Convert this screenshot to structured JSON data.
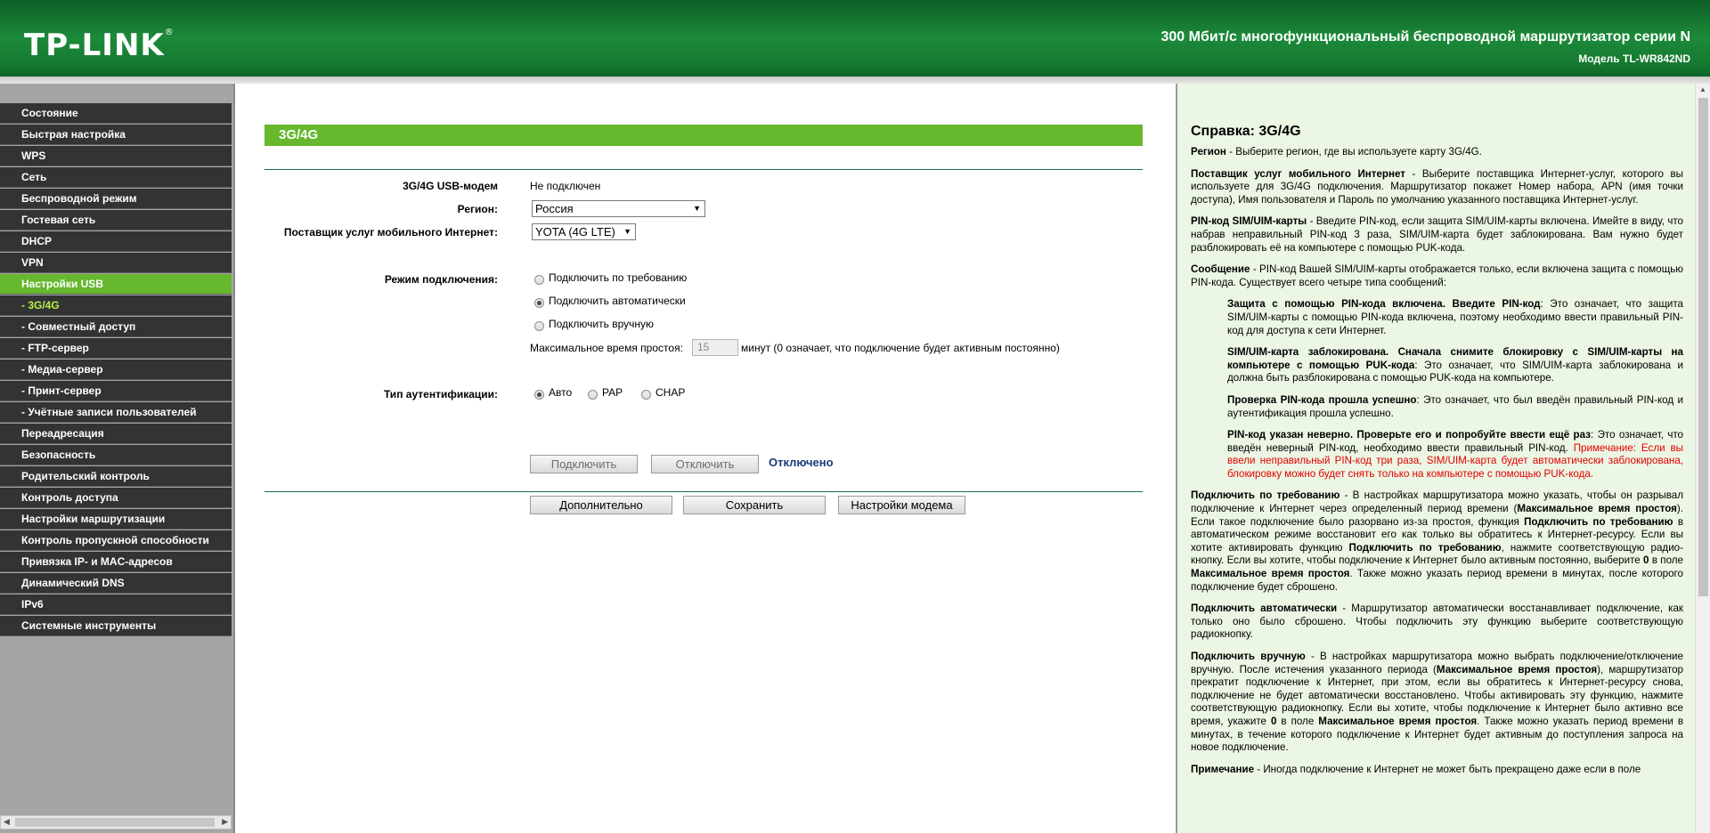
{
  "header": {
    "logo": "TP-LINK",
    "logo_mark": "®",
    "product_title": "300 Мбит/с многофункциональный беспроводной маршрутизатор серии N",
    "model": "Модель TL-WR842ND"
  },
  "sidebar": {
    "items": [
      {
        "label": "Состояние"
      },
      {
        "label": "Быстрая настройка"
      },
      {
        "label": "WPS"
      },
      {
        "label": "Сеть"
      },
      {
        "label": "Беспроводной режим"
      },
      {
        "label": "Гостевая сеть"
      },
      {
        "label": "DHCP"
      },
      {
        "label": "VPN"
      },
      {
        "label": "Настройки USB"
      },
      {
        "label": "- 3G/4G"
      },
      {
        "label": "- Совместный доступ"
      },
      {
        "label": "- FTP-сервер"
      },
      {
        "label": "- Медиа-сервер"
      },
      {
        "label": "- Принт-сервер"
      },
      {
        "label": "- Учётные записи пользователей"
      },
      {
        "label": "Переадресация"
      },
      {
        "label": "Безопасность"
      },
      {
        "label": "Родительский контроль"
      },
      {
        "label": "Контроль доступа"
      },
      {
        "label": "Настройки маршрутизации"
      },
      {
        "label": "Контроль пропускной способности"
      },
      {
        "label": "Привязка IP- и MAC-адресов"
      },
      {
        "label": "Динамический DNS"
      },
      {
        "label": "IPv6"
      },
      {
        "label": "Системные инструменты"
      }
    ]
  },
  "main": {
    "section_title": "3G/4G",
    "modem_label": "3G/4G USB-модем",
    "modem_value": "Не подключен",
    "region_label": "Регион:",
    "region_value": "Россия",
    "provider_label": "Поставщик услуг мобильного Интернет:",
    "provider_value": "YOTA (4G LTE)",
    "mode_label": "Режим подключения:",
    "mode_options": [
      "Подключить по требованию",
      "Подключить автоматически",
      "Подключить вручную"
    ],
    "mode_selected": 1,
    "idle_label": "Максимальное время простоя:",
    "idle_value": "15",
    "idle_suffix": "минут (0 означает, что подключение будет активным постоянно)",
    "auth_label": "Тип аутентификации:",
    "auth_options": [
      "Авто",
      "PAP",
      "CHAP"
    ],
    "auth_selected": 0,
    "connect_button": "Подключить",
    "disconnect_button": "Отключить",
    "status": "Отключено",
    "advanced_button": "Дополнительно",
    "save_button": "Сохранить",
    "modem_settings_button": "Настройки модема"
  },
  "help": {
    "title": "Справка: 3G/4G"
  },
  "colors": {
    "accent_green": "#66b82e",
    "header_green": "#1c8a3a",
    "nav_dark": "#333333",
    "help_bg": "#ecf6e4",
    "warning_red": "#e30000"
  }
}
